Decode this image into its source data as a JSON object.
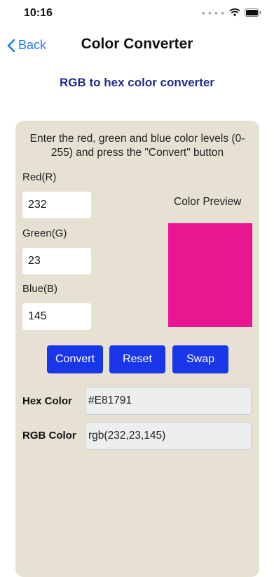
{
  "status": {
    "time": "10:16"
  },
  "nav": {
    "back_label": "Back",
    "title": "Color Converter"
  },
  "subtitle": "RGB to hex color converter",
  "form": {
    "instructions": "Enter the red, green and blue color levels (0-255) and press the \"Convert\" button",
    "red_label": "Red(R)",
    "red_value": "232",
    "green_label": "Green(G)",
    "green_value": "23",
    "blue_label": "Blue(B)",
    "blue_value": "145",
    "preview_label": "Color Preview",
    "preview_color": "#E81791"
  },
  "buttons": {
    "convert": "Convert",
    "reset": "Reset",
    "swap": "Swap"
  },
  "results": {
    "hex_label": "Hex Color",
    "hex_value": "#E81791",
    "rgb_label": "RGB Color",
    "rgb_value": "rgb(232,23,145)"
  },
  "colors": {
    "accent": "#1937E8",
    "link": "#1E7CF2",
    "subtitle": "#1E2F8C",
    "panel": "#E6E1D3"
  }
}
